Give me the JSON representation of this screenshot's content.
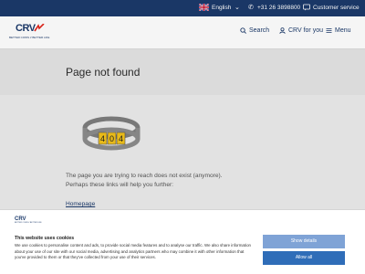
{
  "topbar": {
    "language": "English",
    "phone": "+31 26 3898800",
    "customer_service": "Customer service"
  },
  "header": {
    "logo_text": "CRV",
    "logo_tagline": "BETTER COWS // BETTER LIFE",
    "search_label": "Search",
    "crv_for_you_label": "CRV for you",
    "menu_label": "Menu"
  },
  "main": {
    "title": "Page not found",
    "tag_digits": [
      "4",
      "0",
      "4"
    ],
    "message_line1": "The page you are trying to reach does not exist (anymore).",
    "message_line2": "Perhaps these links will help you further:",
    "homepage_link": "Homepage"
  },
  "cookie": {
    "logo_text": "CRV",
    "logo_tagline": "BETTER COWS // BETTER LIFE",
    "title": "This website uses cookies",
    "text": "We use cookies to personalise content and ads, to provide social media features and to analyse our traffic. We also share information about your use of our site with our social media, advertising and analytics partners who may combine it with other information that you've provided to them or that they've collected from your use of their services.",
    "show_details_label": "Show details",
    "allow_all_label": "Allow all"
  },
  "colors": {
    "brand_navy": "#1c3a6b",
    "accent_red": "#e1251b",
    "tag_yellow": "#f2c21b",
    "button_primary": "#2f6db8",
    "button_secondary": "#7fa3d6"
  },
  "icons": [
    "uk-flag-icon",
    "chevron-down-icon",
    "phone-icon",
    "customer-service-icon",
    "search-icon",
    "user-icon",
    "hamburger-icon"
  ]
}
